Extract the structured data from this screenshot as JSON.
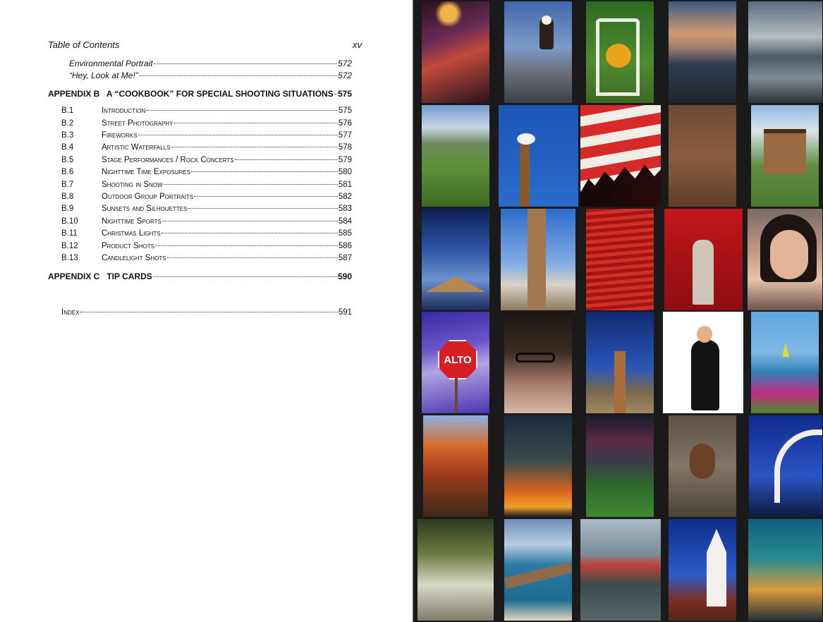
{
  "header": {
    "title": "Table of Contents",
    "page_number": "xv"
  },
  "entries": {
    "env_portrait": {
      "label": "Environmental Portrait",
      "page": "572"
    },
    "hey_look": {
      "label": "“Hey, Look at Me!”",
      "page": "572"
    },
    "appendix_b": {
      "label": "APPENDIX B   A “COOKBOOK” FOR SPECIAL SHOOTING SITUATIONS",
      "page": "575"
    },
    "b1": {
      "code": "B.1",
      "label": "Introduction",
      "page": "575"
    },
    "b2": {
      "code": "B.2",
      "label": "Street Photography",
      "page": "576"
    },
    "b3": {
      "code": "B.3",
      "label": "Fireworks",
      "page": "577"
    },
    "b4": {
      "code": "B.4",
      "label": "Artistic Waterfalls",
      "page": "578"
    },
    "b5": {
      "code": "B.5",
      "label": "Stage Performances / Rock Concerts",
      "page": "579"
    },
    "b6": {
      "code": "B.6",
      "label": "Nighttime Time Exposures",
      "page": "580"
    },
    "b7": {
      "code": "B.7",
      "label": "Shooting in Snow",
      "page": "581"
    },
    "b8": {
      "code": "B.8",
      "label": "Outdoor Group Portraits",
      "page": "582"
    },
    "b9": {
      "code": "B.9",
      "label": "Sunsets and Silhouettes",
      "page": "583"
    },
    "b10": {
      "code": "B.10",
      "label": "Nighttime Sports",
      "page": "584"
    },
    "b11": {
      "code": "B.11",
      "label": "Christmas Lights",
      "page": "585"
    },
    "b12": {
      "code": "B.12",
      "label": "Product Shots",
      "page": "586"
    },
    "b13": {
      "code": "B.13",
      "label": "Candlelight Shots",
      "page": "587"
    },
    "appendix_c": {
      "label": "APPENDIX C   TIP CARDS",
      "page": "590"
    },
    "index": {
      "label": "Index",
      "page": "591"
    }
  },
  "photo_sign_text": "ALTO",
  "colors": {
    "page": "#ffffff",
    "gallery_bg": "#1a1a1a",
    "text": "#111111"
  }
}
